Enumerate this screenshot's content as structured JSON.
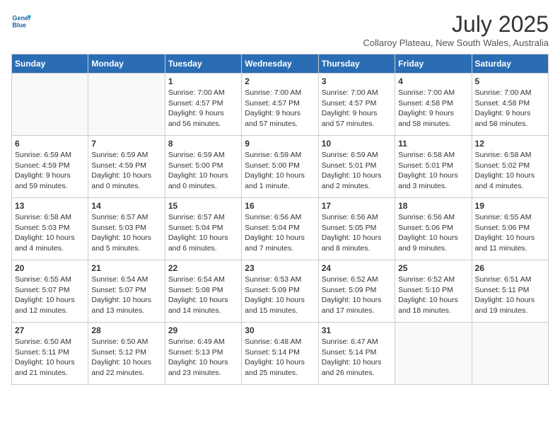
{
  "logo": {
    "line1": "General",
    "line2": "Blue"
  },
  "title": "July 2025",
  "location": "Collaroy Plateau, New South Wales, Australia",
  "days_of_week": [
    "Sunday",
    "Monday",
    "Tuesday",
    "Wednesday",
    "Thursday",
    "Friday",
    "Saturday"
  ],
  "weeks": [
    [
      {
        "day": "",
        "info": ""
      },
      {
        "day": "",
        "info": ""
      },
      {
        "day": "1",
        "info": "Sunrise: 7:00 AM\nSunset: 4:57 PM\nDaylight: 9 hours\nand 56 minutes."
      },
      {
        "day": "2",
        "info": "Sunrise: 7:00 AM\nSunset: 4:57 PM\nDaylight: 9 hours\nand 57 minutes."
      },
      {
        "day": "3",
        "info": "Sunrise: 7:00 AM\nSunset: 4:57 PM\nDaylight: 9 hours\nand 57 minutes."
      },
      {
        "day": "4",
        "info": "Sunrise: 7:00 AM\nSunset: 4:58 PM\nDaylight: 9 hours\nand 58 minutes."
      },
      {
        "day": "5",
        "info": "Sunrise: 7:00 AM\nSunset: 4:58 PM\nDaylight: 9 hours\nand 58 minutes."
      }
    ],
    [
      {
        "day": "6",
        "info": "Sunrise: 6:59 AM\nSunset: 4:59 PM\nDaylight: 9 hours\nand 59 minutes."
      },
      {
        "day": "7",
        "info": "Sunrise: 6:59 AM\nSunset: 4:59 PM\nDaylight: 10 hours\nand 0 minutes."
      },
      {
        "day": "8",
        "info": "Sunrise: 6:59 AM\nSunset: 5:00 PM\nDaylight: 10 hours\nand 0 minutes."
      },
      {
        "day": "9",
        "info": "Sunrise: 6:59 AM\nSunset: 5:00 PM\nDaylight: 10 hours\nand 1 minute."
      },
      {
        "day": "10",
        "info": "Sunrise: 6:59 AM\nSunset: 5:01 PM\nDaylight: 10 hours\nand 2 minutes."
      },
      {
        "day": "11",
        "info": "Sunrise: 6:58 AM\nSunset: 5:01 PM\nDaylight: 10 hours\nand 3 minutes."
      },
      {
        "day": "12",
        "info": "Sunrise: 6:58 AM\nSunset: 5:02 PM\nDaylight: 10 hours\nand 4 minutes."
      }
    ],
    [
      {
        "day": "13",
        "info": "Sunrise: 6:58 AM\nSunset: 5:03 PM\nDaylight: 10 hours\nand 4 minutes."
      },
      {
        "day": "14",
        "info": "Sunrise: 6:57 AM\nSunset: 5:03 PM\nDaylight: 10 hours\nand 5 minutes."
      },
      {
        "day": "15",
        "info": "Sunrise: 6:57 AM\nSunset: 5:04 PM\nDaylight: 10 hours\nand 6 minutes."
      },
      {
        "day": "16",
        "info": "Sunrise: 6:56 AM\nSunset: 5:04 PM\nDaylight: 10 hours\nand 7 minutes."
      },
      {
        "day": "17",
        "info": "Sunrise: 6:56 AM\nSunset: 5:05 PM\nDaylight: 10 hours\nand 8 minutes."
      },
      {
        "day": "18",
        "info": "Sunrise: 6:56 AM\nSunset: 5:06 PM\nDaylight: 10 hours\nand 9 minutes."
      },
      {
        "day": "19",
        "info": "Sunrise: 6:55 AM\nSunset: 5:06 PM\nDaylight: 10 hours\nand 11 minutes."
      }
    ],
    [
      {
        "day": "20",
        "info": "Sunrise: 6:55 AM\nSunset: 5:07 PM\nDaylight: 10 hours\nand 12 minutes."
      },
      {
        "day": "21",
        "info": "Sunrise: 6:54 AM\nSunset: 5:07 PM\nDaylight: 10 hours\nand 13 minutes."
      },
      {
        "day": "22",
        "info": "Sunrise: 6:54 AM\nSunset: 5:08 PM\nDaylight: 10 hours\nand 14 minutes."
      },
      {
        "day": "23",
        "info": "Sunrise: 6:53 AM\nSunset: 5:09 PM\nDaylight: 10 hours\nand 15 minutes."
      },
      {
        "day": "24",
        "info": "Sunrise: 6:52 AM\nSunset: 5:09 PM\nDaylight: 10 hours\nand 17 minutes."
      },
      {
        "day": "25",
        "info": "Sunrise: 6:52 AM\nSunset: 5:10 PM\nDaylight: 10 hours\nand 18 minutes."
      },
      {
        "day": "26",
        "info": "Sunrise: 6:51 AM\nSunset: 5:11 PM\nDaylight: 10 hours\nand 19 minutes."
      }
    ],
    [
      {
        "day": "27",
        "info": "Sunrise: 6:50 AM\nSunset: 5:11 PM\nDaylight: 10 hours\nand 21 minutes."
      },
      {
        "day": "28",
        "info": "Sunrise: 6:50 AM\nSunset: 5:12 PM\nDaylight: 10 hours\nand 22 minutes."
      },
      {
        "day": "29",
        "info": "Sunrise: 6:49 AM\nSunset: 5:13 PM\nDaylight: 10 hours\nand 23 minutes."
      },
      {
        "day": "30",
        "info": "Sunrise: 6:48 AM\nSunset: 5:14 PM\nDaylight: 10 hours\nand 25 minutes."
      },
      {
        "day": "31",
        "info": "Sunrise: 6:47 AM\nSunset: 5:14 PM\nDaylight: 10 hours\nand 26 minutes."
      },
      {
        "day": "",
        "info": ""
      },
      {
        "day": "",
        "info": ""
      }
    ]
  ]
}
